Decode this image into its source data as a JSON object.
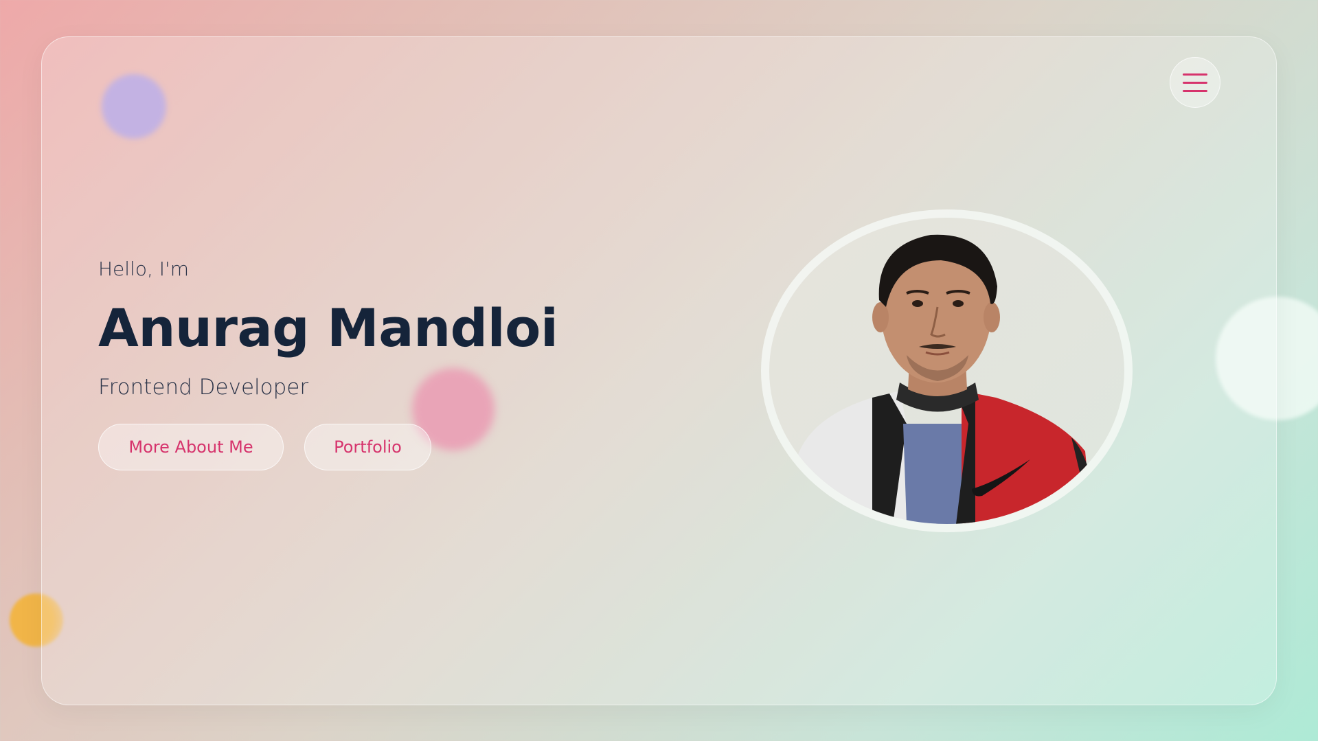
{
  "nav": {
    "menu_icon": "hamburger-icon"
  },
  "hero": {
    "greeting": "Hello, I'm",
    "name": "Anurag Mandloi",
    "role": "Frontend Developer"
  },
  "actions": {
    "about_label": "More About Me",
    "portfolio_label": "Portfolio"
  },
  "profile": {
    "photo_alt": "Anurag Mandloi portrait"
  },
  "colors": {
    "accent": "#d6336c",
    "heading": "#15243a",
    "text": "#2a3348"
  }
}
